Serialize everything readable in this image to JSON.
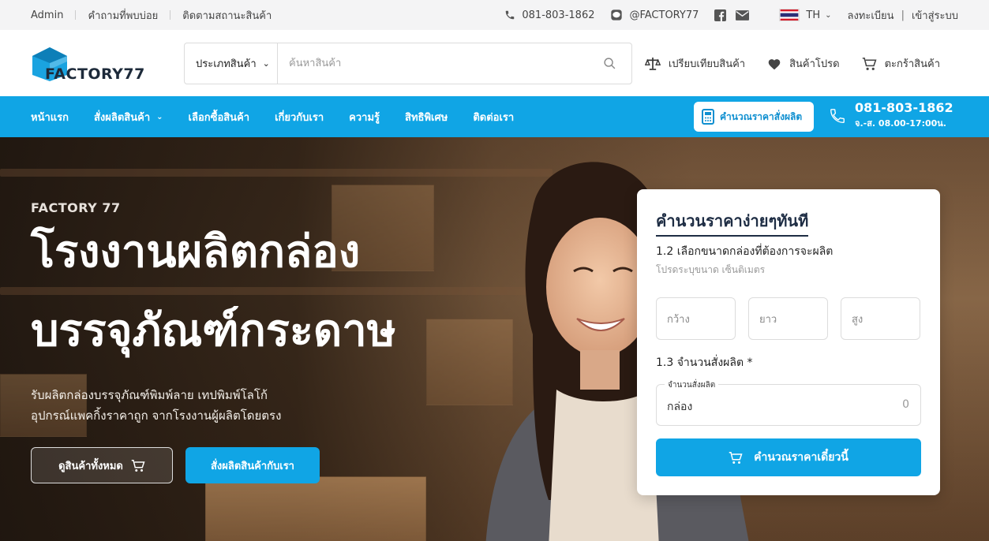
{
  "topbar": {
    "links": [
      "Admin",
      "คำถามที่พบบ่อย",
      "ติดตามสถานะสินค้า"
    ],
    "phone": "081-803-1862",
    "line": "@FACTORY77",
    "lang": "TH",
    "register": "ลงทะเบียน",
    "separator": "|",
    "login": "เข้าสู่ระบบ"
  },
  "header": {
    "logo_text": "FACTORY77",
    "search_category": "ประเภทสินค้า",
    "search_placeholder": "ค้นหาสินค้า",
    "compare": "เปรียบเทียบสินค้า",
    "favorites": "สินค้าโปรด",
    "cart": "ตะกร้าสินค้า"
  },
  "nav": {
    "items": [
      "หน้าแรก",
      "สั่งผลิตสินค้า",
      "เลือกซื้อสินค้า",
      "เกี่ยวกับเรา",
      "ความรู้",
      "สิทธิพิเศษ",
      "ติดต่อเรา"
    ],
    "calc_button": "คำนวณราคาสั่งผลิต",
    "phone": "081-803-1862",
    "hours": "จ.-ส. 08.00-17:00น."
  },
  "hero": {
    "eyebrow": "FACTORY 77",
    "title_line1": "โรงงานผลิตกล่อง",
    "title_line2": "บรรจุภัณฑ์กระดาษ",
    "desc_line1": "รับผลิตกล่องบรรจุภัณฑ์พิมพ์ลาย เทปพิมพ์โลโก้",
    "desc_line2": "อุปกรณ์แพคกิ้งราคาถูก จากโรงงานผู้ผลิตโดยตรง",
    "btn_all": "ดูสินค้าทั้งหมด",
    "btn_order": "สั่งผลิตสินค้ากับเรา"
  },
  "calculator": {
    "title": "คำนวนราคาง่ายๆทันที",
    "step1": "1.2 เลือกขนาดกล่องที่ต้องการจะผลิต",
    "step1_hint": "โปรดระบุขนาด เซ็นติเมตร",
    "width_ph": "กว้าง",
    "length_ph": "ยาว",
    "height_ph": "สูง",
    "step2": "1.3 จำนวนสั่งผลิต *",
    "qty_label": "จำนวนสั่งผลิต",
    "qty_unit": "กล่อง",
    "qty_value": "0",
    "submit": "คำนวณราคาเดี๋ยวนี้"
  },
  "colors": {
    "brand_blue": "#10a5e5",
    "navy": "#1e2d44"
  }
}
